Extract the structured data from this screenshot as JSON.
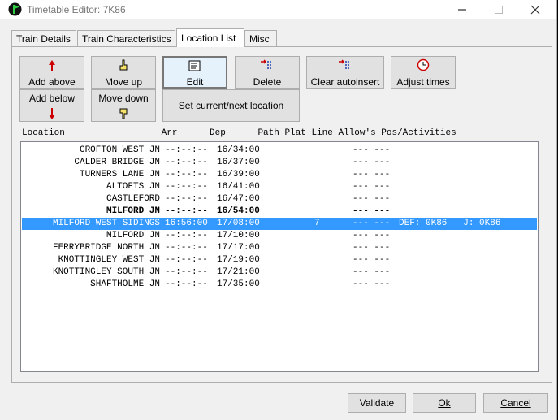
{
  "window": {
    "title": "Timetable Editor: 7K86"
  },
  "tabs": [
    {
      "label": "Train Details"
    },
    {
      "label": "Train Characteristics"
    },
    {
      "label": "Location List"
    },
    {
      "label": "Misc"
    }
  ],
  "toolbar": {
    "add_above": "Add above",
    "add_below": "Add below",
    "move_up": "Move up",
    "move_down": "Move down",
    "edit": "Edit",
    "delete": "Delete",
    "clear_autoinsert": "Clear autoinsert",
    "adjust_times": "Adjust times",
    "set_current": "Set current/next location"
  },
  "list": {
    "header": "Location                  Arr      Dep      Path Plat Line Allow's Pos/Activities",
    "rows": [
      {
        "loc": "CROFTON WEST JN",
        "arr": "--:--:--",
        "dep": "16/34:00",
        "plat": "",
        "allow": "--- ---",
        "act": ""
      },
      {
        "loc": "CALDER BRIDGE JN",
        "arr": "--:--:--",
        "dep": "16/37:00",
        "plat": "",
        "allow": "--- ---",
        "act": ""
      },
      {
        "loc": "TURNERS LANE JN",
        "arr": "--:--:--",
        "dep": "16/39:00",
        "plat": "",
        "allow": "--- ---",
        "act": ""
      },
      {
        "loc": "ALTOFTS JN",
        "arr": "--:--:--",
        "dep": "16/41:00",
        "plat": "",
        "allow": "--- ---",
        "act": ""
      },
      {
        "loc": "CASTLEFORD",
        "arr": "--:--:--",
        "dep": "16/47:00",
        "plat": "",
        "allow": "--- ---",
        "act": ""
      },
      {
        "loc": "MILFORD JN",
        "arr": "--:--:--",
        "dep": "16/54:00",
        "plat": "",
        "allow": "--- ---",
        "act": ""
      },
      {
        "loc": "MILFORD WEST SIDINGS",
        "arr": "16:56:00",
        "dep": "17/08:00",
        "plat": "7",
        "allow": "--- ---",
        "act": "DEF: 0K86   J: 0K86"
      },
      {
        "loc": "MILFORD JN",
        "arr": "--:--:--",
        "dep": "17/10:00",
        "plat": "",
        "allow": "--- ---",
        "act": ""
      },
      {
        "loc": "FERRYBRIDGE NORTH JN",
        "arr": "--:--:--",
        "dep": "17/17:00",
        "plat": "",
        "allow": "--- ---",
        "act": ""
      },
      {
        "loc": "KNOTTINGLEY WEST JN",
        "arr": "--:--:--",
        "dep": "17/19:00",
        "plat": "",
        "allow": "--- ---",
        "act": ""
      },
      {
        "loc": "KNOTTINGLEY SOUTH JN",
        "arr": "--:--:--",
        "dep": "17/21:00",
        "plat": "",
        "allow": "--- ---",
        "act": ""
      },
      {
        "loc": "SHAFTHOLME JN",
        "arr": "--:--:--",
        "dep": "17/35:00",
        "plat": "",
        "allow": "--- ---",
        "act": ""
      }
    ]
  },
  "footer": {
    "validate": "Validate",
    "ok": "Ok",
    "cancel": "Cancel"
  },
  "colors": {
    "selection": "#3399ff",
    "window_bg": "#f0f0f0",
    "button_bg": "#e1e1e1"
  }
}
